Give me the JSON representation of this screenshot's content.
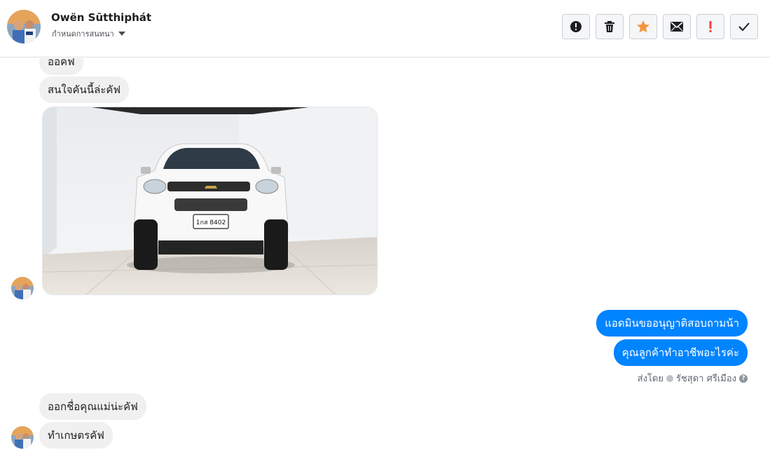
{
  "header": {
    "name": "Owën Sūtthiphát",
    "subtitle": "กำหนดการสนทนา"
  },
  "toolbar": {
    "buttons": [
      {
        "icon": "alert-circle-icon",
        "color": "#1c1e21"
      },
      {
        "icon": "trash-icon",
        "color": "#1c1e21"
      },
      {
        "icon": "star-icon",
        "color": "#f7923b"
      },
      {
        "icon": "envelope-icon",
        "color": "#1c1e21"
      },
      {
        "icon": "exclamation-icon",
        "color": "#fa3e3e"
      },
      {
        "icon": "check-icon",
        "color": "#1c1e21"
      }
    ]
  },
  "messages": {
    "in_1": "ออคฟ",
    "in_2": "สนใจคันนี้ล่ะคัฟ",
    "photo_plate": "1กส 8402",
    "out_1": "แอดมินขออนุญาติสอบถามน้า",
    "out_2": "คุณลูกค้าทำอาชีพอะไรค่ะ",
    "in_3": "ออกชื่อคุณแม่น่ะคัฟ",
    "in_4": "ทำเกษตรคัฟ"
  },
  "sent_by": {
    "prefix": "ส่งโดย",
    "agent": "รัชสุดา ศรีเมือง",
    "help": "?"
  },
  "colors": {
    "outgoing": "#0084ff",
    "incoming": "#f1f0f0",
    "star": "#f7923b",
    "flag": "#fa3e3e"
  }
}
